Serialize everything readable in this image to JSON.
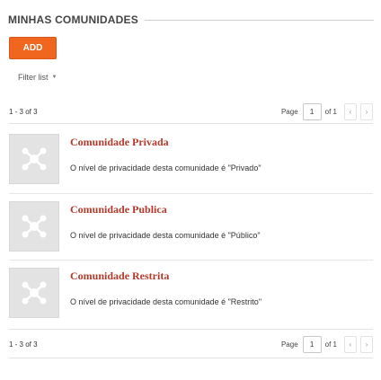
{
  "header": {
    "title": "MINHAS COMUNIDADES"
  },
  "toolbar": {
    "add_label": "ADD",
    "filter_label": "Filter list"
  },
  "pagination": {
    "count_label": "1 - 3 of 3",
    "page_label": "Page",
    "current_page": "1",
    "of_label": "of 1",
    "prev_icon": "‹",
    "next_icon": "›"
  },
  "communities": [
    {
      "title": "Comunidade Privada",
      "description": "O nível de privacidade desta comunidade é \"Privado\""
    },
    {
      "title": "Comunidade Publica",
      "description": "O nível de privacidade desta comunidade é \"Público\""
    },
    {
      "title": "Comunidade Restrita",
      "description": "O nível de privacidade desta comunidade é \"Restrito\""
    }
  ],
  "colors": {
    "accent": "#f1661f",
    "link": "#b33a2a",
    "thumb": "#e3e3e3"
  },
  "icons": {
    "thumb": "community-network-icon",
    "filter_caret": "caret-down-icon"
  }
}
